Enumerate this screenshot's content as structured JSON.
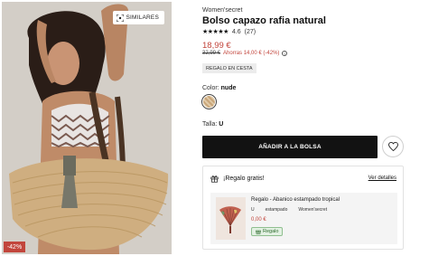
{
  "photo": {
    "similares_label": "SIMILARES",
    "discount_badge": "-42%"
  },
  "product": {
    "brand": "Women'secret",
    "title": "Bolso capazo rafia natural",
    "stars": "★★★★★",
    "rating": "4.6",
    "reviews": "(27)",
    "price": "18,99 €",
    "old_price": "32,99 €",
    "savings": "Ahorras 14,00 € (-42%)",
    "gift_tag": "REGALO EN CESTA",
    "color_label": "Color:",
    "color_value": "nude",
    "size_label": "Talla:",
    "size_value": "U",
    "add_to_bag": "AÑADIR A LA BOLSA"
  },
  "gift": {
    "heading": "¡Regalo gratis!",
    "details_link": "Ver detalles",
    "item_title": "Regalo - Abanico estampado tropical",
    "meta": [
      "U",
      "estampado",
      "Women'secret"
    ],
    "item_price": "0,00 €",
    "badge": "Regalo"
  },
  "colors": {
    "accent_red": "#c2453c",
    "button_dark": "#121212",
    "badge_green": "#e3f1e3"
  },
  "icons": [
    "scan-icon",
    "star-icon",
    "info-icon",
    "heart-icon",
    "gift-icon"
  ]
}
